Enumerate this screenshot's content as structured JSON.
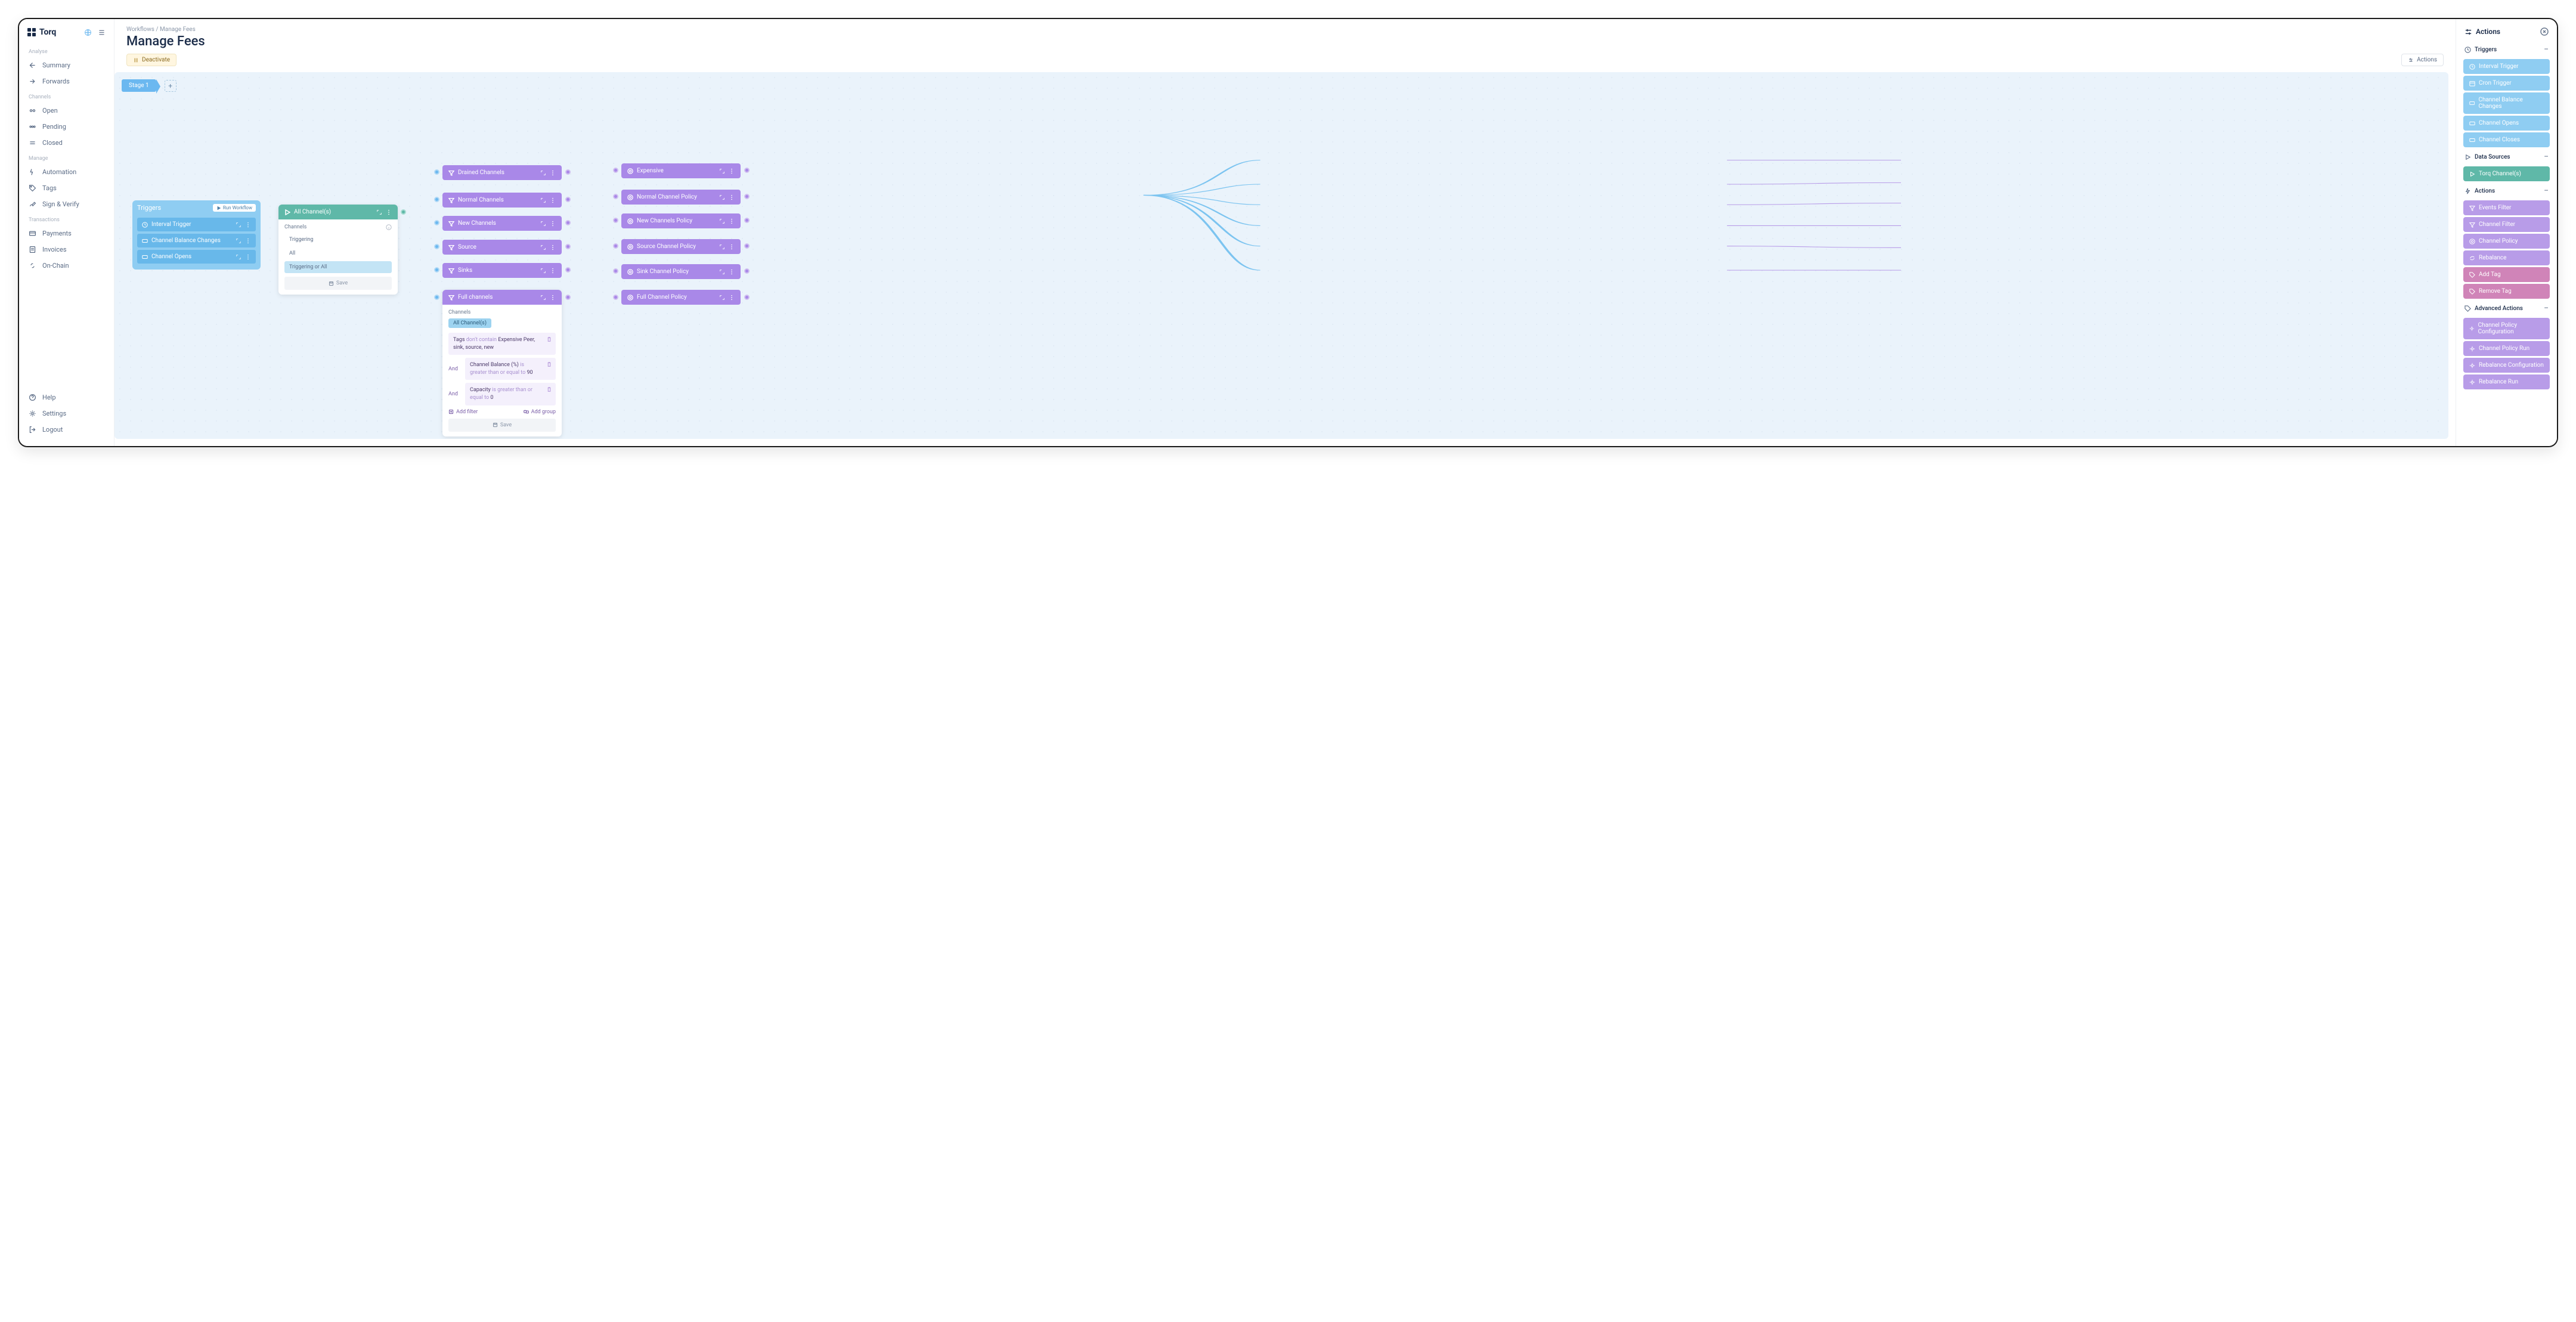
{
  "app": {
    "name": "Torq"
  },
  "sidebar": {
    "sections": {
      "analyse": "Analyse",
      "channels": "Channels",
      "manage": "Manage",
      "transactions": "Transactions"
    },
    "items": {
      "summary": "Summary",
      "forwards": "Forwards",
      "open": "Open",
      "pending": "Pending",
      "closed": "Closed",
      "automation": "Automation",
      "tags": "Tags",
      "signverify": "Sign & Verify",
      "payments": "Payments",
      "invoices": "Invoices",
      "onchain": "On-Chain",
      "help": "Help",
      "settings": "Settings",
      "logout": "Logout"
    }
  },
  "header": {
    "breadcrumb_a": "Workflows",
    "breadcrumb_b": "Manage Fees",
    "title": "Manage Fees",
    "deactivate": "Deactivate",
    "actions": "Actions"
  },
  "canvas": {
    "stage": "Stage 1",
    "triggers_card": {
      "title": "Triggers",
      "run": "Run Workflow",
      "rows": [
        "Interval Trigger",
        "Channel Balance Changes",
        "Channel Opens"
      ]
    },
    "source_card": {
      "title": "All Channel(s)",
      "section": "Channels",
      "opts": [
        "Triggering",
        "All",
        "Triggering or All"
      ],
      "save": "Save"
    },
    "filters": {
      "drained": "Drained Channels",
      "normal": "Normal Channels",
      "new": "New Channels",
      "source": "Source",
      "sinks": "Sinks",
      "full": "Full channels"
    },
    "policies": {
      "expensive": "Expensive",
      "normal": "Normal Channel Policy",
      "new": "New Channels Policy",
      "source": "Source Channel Policy",
      "sink": "Sink Channel Policy",
      "full": "Full Channel Policy"
    },
    "full_card": {
      "section": "Channels",
      "chip": "All Channel(s)",
      "rule1_a": "Tags",
      "rule1_b": "don't contain",
      "rule1_c": "Expensive Peer, sink, source, new",
      "rule2_a": "Channel Balance (%)",
      "rule2_b": "is greater than or equal to",
      "rule2_c": "90",
      "rule3_a": "Capacity",
      "rule3_b": "is greater than or equal to",
      "rule3_c": "0",
      "and": "And",
      "add_filter": "Add filter",
      "add_group": "Add group",
      "save": "Save"
    }
  },
  "right_panel": {
    "title": "Actions",
    "sections": {
      "triggers": "Triggers",
      "datasources": "Data Sources",
      "actions": "Actions",
      "advanced": "Advanced Actions"
    },
    "triggers": [
      "Interval Trigger",
      "Cron Trigger",
      "Channel Balance Changes",
      "Channel Opens",
      "Channel Closes"
    ],
    "datasources": [
      "Torq Channel(s)"
    ],
    "actions_list": [
      "Events Filter",
      "Channel Filter",
      "Channel Policy",
      "Rebalance",
      "Add Tag",
      "Remove Tag"
    ],
    "advanced": [
      "Channel Policy Configuration",
      "Channel Policy Run",
      "Rebalance Configuration",
      "Rebalance Run"
    ]
  }
}
